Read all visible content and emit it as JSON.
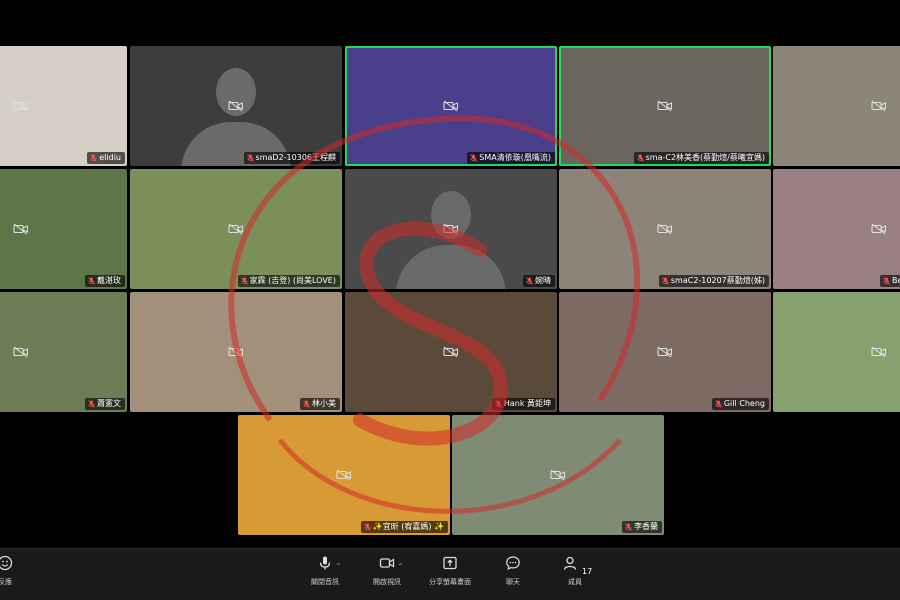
{
  "participants": [
    {
      "name": "elidiu",
      "video": true,
      "bg": "#d6cfc6",
      "speaking": false
    },
    {
      "name": "smaD2-10306王程麒",
      "video": false,
      "bg": "#3d3d3d",
      "speaking": false
    },
    {
      "name": "SMA清依璇(凰嘴流)",
      "video": true,
      "bg": "#4a3f8a",
      "speaking": true
    },
    {
      "name": "sma-C2林美香(蔡勤煊/蔡曦宜媽)",
      "video": true,
      "bg": "#6b6560",
      "speaking": true
    },
    {
      "name": "",
      "video": true,
      "bg": "#8c8679",
      "speaking": false
    },
    {
      "name": "戴湛玫",
      "video": true,
      "bg": "#5e7548",
      "speaking": false
    },
    {
      "name": "家霖 (吉登) (尚美LOVE)",
      "video": true,
      "bg": "#7b8f5a",
      "speaking": false
    },
    {
      "name": "婉晴",
      "video": false,
      "bg": "#4a4a4a",
      "speaking": false
    },
    {
      "name": "smaC2-10207蔡勤煊(姊)",
      "video": true,
      "bg": "#8d8378",
      "speaking": false
    },
    {
      "name": "Be",
      "video": true,
      "bg": "#9a7f84",
      "speaking": false
    },
    {
      "name": "蕭憲文",
      "video": true,
      "bg": "#6c7d55",
      "speaking": false
    },
    {
      "name": "林小美",
      "video": true,
      "bg": "#a2907a",
      "speaking": false
    },
    {
      "name": "Hank 黃鉅坤",
      "video": true,
      "bg": "#5b4a3a",
      "speaking": false
    },
    {
      "name": "Gill Cheng",
      "video": true,
      "bg": "#7d6b63",
      "speaking": false
    },
    {
      "name": "",
      "video": true,
      "bg": "#86a06e",
      "speaking": false
    },
    {
      "name": "✨宜昕 (宥嘉媽) ✨",
      "video": true,
      "bg": "#d79a34",
      "speaking": false
    },
    {
      "name": "李香蘭",
      "video": true,
      "bg": "#7f8b72",
      "speaking": false
    }
  ],
  "toolbar": {
    "reactions_label": "反應",
    "audio_label": "關閉音訊",
    "video_label": "開啟視訊",
    "share_label": "分享螢幕畫面",
    "chat_label": "聊天",
    "participants_label": "成員",
    "participant_count": "17"
  },
  "colors": {
    "speaking_border": "#23d959",
    "toolbar_bg": "#1a1a1a",
    "watermark": "#d22a2a"
  }
}
